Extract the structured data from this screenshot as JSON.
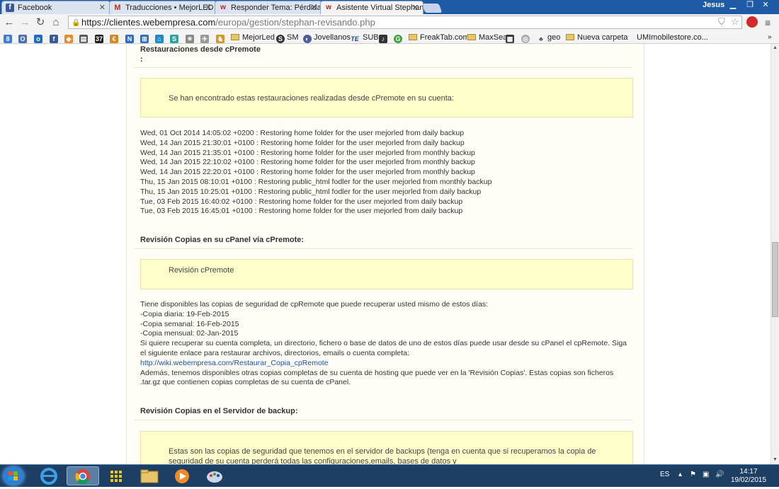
{
  "window": {
    "user": "Jesus",
    "tabs": [
      {
        "label": "Facebook",
        "icon": "facebook-icon"
      },
      {
        "label": "Traducciones • MejorLED",
        "icon": "mejorled-icon"
      },
      {
        "label": "Responder Tema: Pérdida",
        "icon": "webempresa-icon"
      },
      {
        "label": "Asistente Virtual Stephan",
        "icon": "webempresa-icon"
      }
    ]
  },
  "address": {
    "host": "https://clientes.webempresa.com",
    "path": "/europa/gestion/stephan-revisando.php"
  },
  "bookmarks": [
    {
      "label": "MejorLed",
      "icon": "folder-icon"
    },
    {
      "label": "SM",
      "icon": "sm-icon"
    },
    {
      "label": "Jovellanos",
      "icon": "globe-icon"
    },
    {
      "label": "SUB",
      "icon": "te-icon"
    },
    {
      "label": "FreakTab.com",
      "icon": "folder-icon"
    },
    {
      "label": "MaxSea",
      "icon": "folder-icon"
    },
    {
      "label": "geo",
      "icon": "geo-icon"
    },
    {
      "label": "Nueva carpeta",
      "icon": "folder-icon"
    },
    {
      "label": "UMImobilestore.co...",
      "icon": "page-icon"
    }
  ],
  "content": {
    "restorations": {
      "heading": "Restauraciones desde cPremote",
      "colon": ":",
      "box": "Se han encontrado estas restauraciones realizadas desde cPremote en su cuenta:",
      "log": [
        "Wed, 01 Oct 2014 14:05:02 +0200 : Restoring home folder for the user mejorled from daily backup",
        "Wed, 14 Jan 2015 21:30:01 +0100 : Restoring home folder for the user mejorled from daily backup",
        "Wed, 14 Jan 2015 21:35:01 +0100 : Restoring home folder for the user mejorled from monthly backup",
        "Wed, 14 Jan 2015 22:10:02 +0100 : Restoring home folder for the user mejorled from monthly backup",
        "Wed, 14 Jan 2015 22:20:01 +0100 : Restoring home folder for the user mejorled from monthly backup",
        "Thu, 15 Jan 2015 08:10:01 +0100 : Restoring public_html fodler for the user mejorled from monthly backup",
        "Thu, 15 Jan 2015 10:25:01 +0100 : Restoring public_html fodler for the user mejorled from daily backup",
        "Tue, 03 Feb 2015 16:40:02 +0100 : Restoring home folder for the user mejorled from daily backup",
        "Tue, 03 Feb 2015 16:45:01 +0100 : Restoring home folder for the user mejorled from daily backup"
      ]
    },
    "cpanel": {
      "heading": "Revisión Copias en su cPanel vía cPremote:",
      "box": "Revisión cPremote",
      "p1": "Tiene disponibles las copias de seguridad de cpRemote que puede recuperar usted mismo de estos días:",
      "daily": "-Copia diaria: 19-Feb-2015",
      "weekly": "-Copia semanal: 16-Feb-2015",
      "monthly": "-Copia mensual: 02-Jan-2015",
      "p2": "Si quiere recuperar su cuenta completa, un directorio, fichero o base de datos de uno de estos días puede usar desde su cPanel el cpRemote. Siga el siguiente enlace para restaurar archivos, directorios, emails o cuenta completa:",
      "link": "http://wiki.webempresa.com/Restaurar_Copia_cpRemote",
      "p3": "Además, tenemos disponibles otras copias completas de su cuenta de hosting que puede ver en la 'Revisión Copias'. Estas copias son ficheros .tar.gz que contienen copias completas de su cuenta de cPanel."
    },
    "server": {
      "heading": "Revisión Copias en el Servidor de backup:",
      "box": "Estas son las copias de seguridad que tenemos en el servidor de backups (tenga en cuenta que si recuperamos la copia de seguridad de su cuenta perderá todas las configuraciones,emails, bases de datos y"
    }
  },
  "taskbar": {
    "lang": "ES",
    "time": "14:17",
    "date": "19/02/2015"
  },
  "colors": {
    "accent_link": "#1c4fb5",
    "notice_bg": "#ffffcc",
    "tabstrip": "#1f5aa6"
  }
}
